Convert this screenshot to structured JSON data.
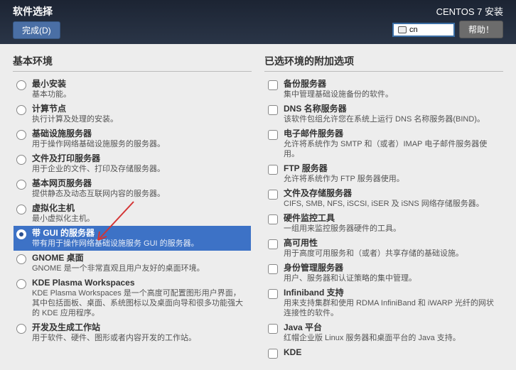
{
  "header": {
    "title": "软件选择",
    "done_label": "完成(D)",
    "install_label": "CENTOS 7 安装",
    "lang_text": "cn",
    "help_label": "帮助！"
  },
  "left": {
    "heading": "基本环境",
    "items": [
      {
        "label": "最小安装",
        "desc": "基本功能。"
      },
      {
        "label": "计算节点",
        "desc": "执行计算及处理的安装。"
      },
      {
        "label": "基础设施服务器",
        "desc": "用于操作网络基础设施服务的服务器。"
      },
      {
        "label": "文件及打印服务器",
        "desc": "用于企业的文件、打印及存储服务器。"
      },
      {
        "label": "基本网页服务器",
        "desc": "提供静态及动态互联网内容的服务器。"
      },
      {
        "label": "虚拟化主机",
        "desc": "最小虚拟化主机。"
      },
      {
        "label": "带 GUI 的服务器",
        "desc": "带有用于操作网络基础设施服务 GUI 的服务器。"
      },
      {
        "label": "GNOME 桌面",
        "desc": "GNOME 是一个非常直观且用户友好的桌面环境。"
      },
      {
        "label": "KDE Plasma Workspaces",
        "desc": "KDE Plasma Workspaces 是一个高度可配置图形用户界面，其中包括面板、桌面、系统图标以及桌面向导和很多功能强大的 KDE 应用程序。"
      },
      {
        "label": "开发及生成工作站",
        "desc": "用于软件、硬件、图形或者内容开发的工作站。"
      }
    ],
    "selected_index": 6
  },
  "right": {
    "heading": "已选环境的附加选项",
    "items": [
      {
        "label": "备份服务器",
        "desc": "集中管理基础设施备份的软件。"
      },
      {
        "label": "DNS 名称服务器",
        "desc": "该软件包组允许您在系统上运行 DNS 名称服务器(BIND)。"
      },
      {
        "label": "电子邮件服务器",
        "desc": "允许将系统作为 SMTP 和（或者）IMAP 电子邮件服务器使用。"
      },
      {
        "label": "FTP 服务器",
        "desc": "允许将系统作为 FTP 服务器使用。"
      },
      {
        "label": "文件及存储服务器",
        "desc": "CIFS, SMB, NFS, iSCSI, iSER 及 iSNS 网络存储服务器。"
      },
      {
        "label": "硬件监控工具",
        "desc": "一组用来监控服务器硬件的工具。"
      },
      {
        "label": "高可用性",
        "desc": "用于高度可用服务和（或者）共享存储的基础设施。"
      },
      {
        "label": "身份管理服务器",
        "desc": "用户、服务器和认证策略的集中管理。"
      },
      {
        "label": "Infiniband 支持",
        "desc": "用来支持集群和使用 RDMA InfiniBand 和 iWARP 光纤的网状连接性的软件。"
      },
      {
        "label": "Java 平台",
        "desc": "红帽企业版 Linux 服务器和桌面平台的 Java 支持。"
      },
      {
        "label": "KDE",
        "desc": ""
      }
    ]
  }
}
